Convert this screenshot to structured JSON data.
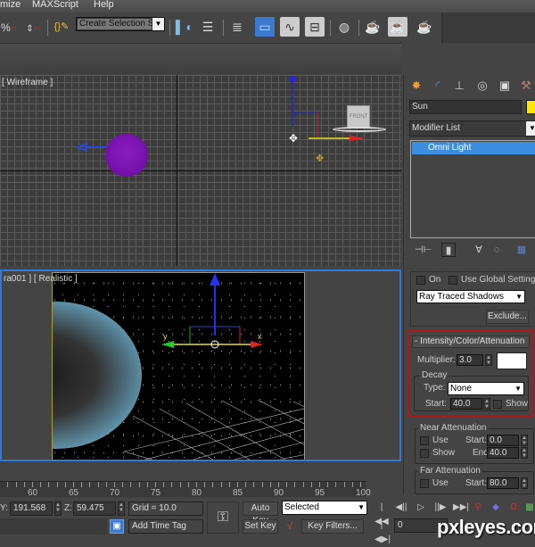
{
  "menu": {
    "items": [
      "mize",
      "MAXScript",
      "Help"
    ]
  },
  "toolbar": {
    "selection_set_value": "Create Selection Se",
    "icons": [
      "percent-snap-icon",
      "spinner-snap-icon",
      "edit-named-selection-icon",
      "mirror-icon",
      "align-icon",
      "layer-manager-icon",
      "scene-explorer-icon",
      "curve-editor-icon",
      "schematic-view-icon",
      "material-editor-icon",
      "render-setup-icon",
      "rendered-frame-window-icon",
      "render-production-icon"
    ]
  },
  "viewports": {
    "top": {
      "label": "[ Wireframe ]",
      "viewcube_label": "FRONT"
    },
    "bottom": {
      "label": "ra001 ] [ Realistic ]",
      "gizmo_x_label": "x",
      "gizmo_y_label": "y"
    }
  },
  "command_panel": {
    "tabs": [
      "create-tab",
      "modify-tab",
      "hierarchy-tab",
      "motion-tab",
      "display-tab",
      "utilities-tab"
    ],
    "object_name": "Sun",
    "object_color": "#ffe400",
    "modifier_list_label": "Modifier List",
    "stack_items": [
      "Omni Light"
    ],
    "shadows": {
      "on_label": "On",
      "on_checked": false,
      "global_label": "Use Global Settings",
      "global_checked": false,
      "shadow_type": "Ray Traced Shadows",
      "exclude_label": "Exclude..."
    },
    "intensity": {
      "title": "- Intensity/Color/Attenuation",
      "multiplier_label": "Multiplier:",
      "multiplier_value": "3.0",
      "light_color": "#ffffff",
      "decay_title": "Decay",
      "type_label": "Type:",
      "type_value": "None",
      "start_label": "Start:",
      "start_value": "40.0",
      "show_label": "Show",
      "show_checked": false
    },
    "near_attenuation": {
      "title": "Near Attenuation",
      "use_label": "Use",
      "show_label": "Show",
      "start_label": "Start:",
      "start_value": "0.0",
      "end_label": "End:",
      "end_value": "40.0"
    },
    "far_attenuation": {
      "title": "Far Attenuation",
      "use_label": "Use",
      "start_label": "Start:",
      "start_value": "80.0"
    }
  },
  "timeline": {
    "tick_labels": [
      "60",
      "65",
      "70",
      "75",
      "80",
      "85",
      "90",
      "95",
      "100"
    ]
  },
  "status": {
    "y_label": "Y:",
    "y_value": "191.568",
    "z_label": "Z:",
    "z_value": "59.475",
    "grid": "Grid = 10.0",
    "add_time_tag": "Add Time Tag",
    "auto_key": "Auto Key",
    "set_key": "Set Key",
    "key_mode": "Selected",
    "key_filters": "Key Filters...",
    "current_frame": "0"
  },
  "watermark": "pxleyes.com"
}
